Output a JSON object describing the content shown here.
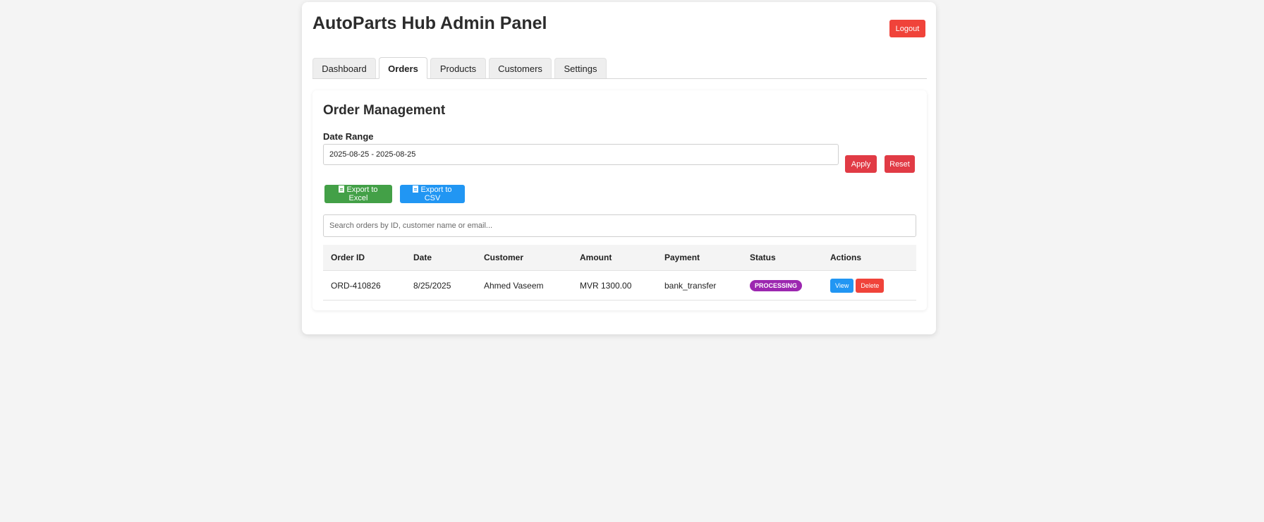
{
  "header": {
    "title": "AutoParts Hub Admin Panel",
    "logout_label": "Logout"
  },
  "tabs": [
    {
      "label": "Dashboard",
      "active": false
    },
    {
      "label": "Orders",
      "active": true
    },
    {
      "label": "Products",
      "active": false
    },
    {
      "label": "Customers",
      "active": false
    },
    {
      "label": "Settings",
      "active": false
    }
  ],
  "orders_section": {
    "title": "Order Management",
    "date_range_label": "Date Range",
    "date_range_value": "2025-08-25 - 2025-08-25",
    "apply_label": "Apply",
    "reset_label": "Reset",
    "export_excel_label": "Export to Excel",
    "export_csv_label": "Export to CSV",
    "search_placeholder": "Search orders by ID, customer name or email...",
    "table": {
      "columns": [
        "Order ID",
        "Date",
        "Customer",
        "Amount",
        "Payment",
        "Status",
        "Actions"
      ],
      "rows": [
        {
          "order_id": "ORD-410826",
          "date": "8/25/2025",
          "customer": "Ahmed Vaseem",
          "amount": "MVR 1300.00",
          "payment": "bank_transfer",
          "status": "PROCESSING",
          "view_label": "View",
          "delete_label": "Delete"
        }
      ]
    }
  },
  "colors": {
    "danger": "#f0433a",
    "apply_reset": "#e13b45",
    "excel": "#43a047",
    "primary": "#2196f3",
    "status_processing": "#9c27b0",
    "background": "#f4f4f4"
  },
  "icons": {
    "export_excel": "file-excel-icon",
    "export_csv": "file-csv-icon"
  }
}
